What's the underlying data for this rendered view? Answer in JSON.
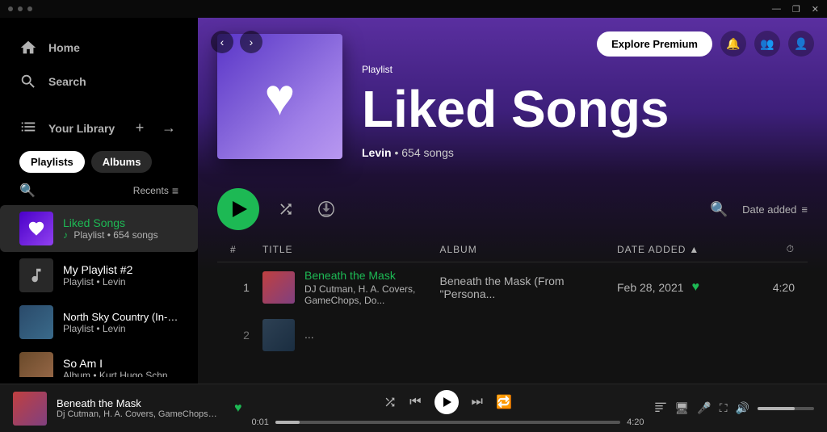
{
  "titlebar": {
    "controls": [
      "—",
      "❐",
      "✕"
    ]
  },
  "sidebar": {
    "nav": [
      {
        "id": "home",
        "label": "Home",
        "icon": "home"
      },
      {
        "id": "search",
        "label": "Search",
        "icon": "search"
      }
    ],
    "library": {
      "label": "Your Library",
      "filters": [
        "Playlists",
        "Albums"
      ],
      "active_filter": "Playlists",
      "search_icon": "🔍",
      "recents_label": "Recents"
    },
    "items": [
      {
        "id": "liked-songs",
        "name": "Liked Songs",
        "meta": "Playlist • 654 songs",
        "type": "liked",
        "active": true
      },
      {
        "id": "my-playlist-2",
        "name": "My Playlist #2",
        "meta": "Playlist • Levin",
        "type": "playlist"
      },
      {
        "id": "north-sky",
        "name": "North Sky Country (In-Game)",
        "meta": "Playlist • Levin",
        "type": "playlist"
      },
      {
        "id": "so-am-i",
        "name": "So Am I",
        "meta": "Album • Kurt Hugo Schneider",
        "type": "album"
      }
    ]
  },
  "hero": {
    "back_btn": "‹",
    "forward_btn": "›",
    "type_label": "Playlist",
    "title": "Liked Songs",
    "user": "Levin",
    "song_count": "654 songs",
    "explore_btn": "Explore Premium"
  },
  "controls": {
    "date_added_label": "Date added",
    "list_icon": "≡",
    "search_icon": "🔍"
  },
  "table": {
    "headers": [
      "#",
      "Title",
      "Album",
      "Date added",
      "⏱"
    ],
    "rows": [
      {
        "num": "1",
        "title": "Beneath the Mask",
        "artist": "DJ Cutman, H. A. Covers, GameChops, Do...",
        "album": "Beneath the Mask (From \"Persona...",
        "date": "Feb 28, 2021",
        "liked": true,
        "duration": "4:20",
        "cover_type": "1"
      },
      {
        "num": "2",
        "title": "",
        "artist": "",
        "album": "",
        "date": "",
        "liked": false,
        "duration": "",
        "cover_type": "2",
        "partial": true
      }
    ]
  },
  "now_playing": {
    "title": "Beneath the Mask",
    "artist": "Dj Cutman, H. A. Covers, GameChops, Dodger",
    "liked": true,
    "current_time": "0:01",
    "total_time": "4:20",
    "progress_pct": 7
  }
}
